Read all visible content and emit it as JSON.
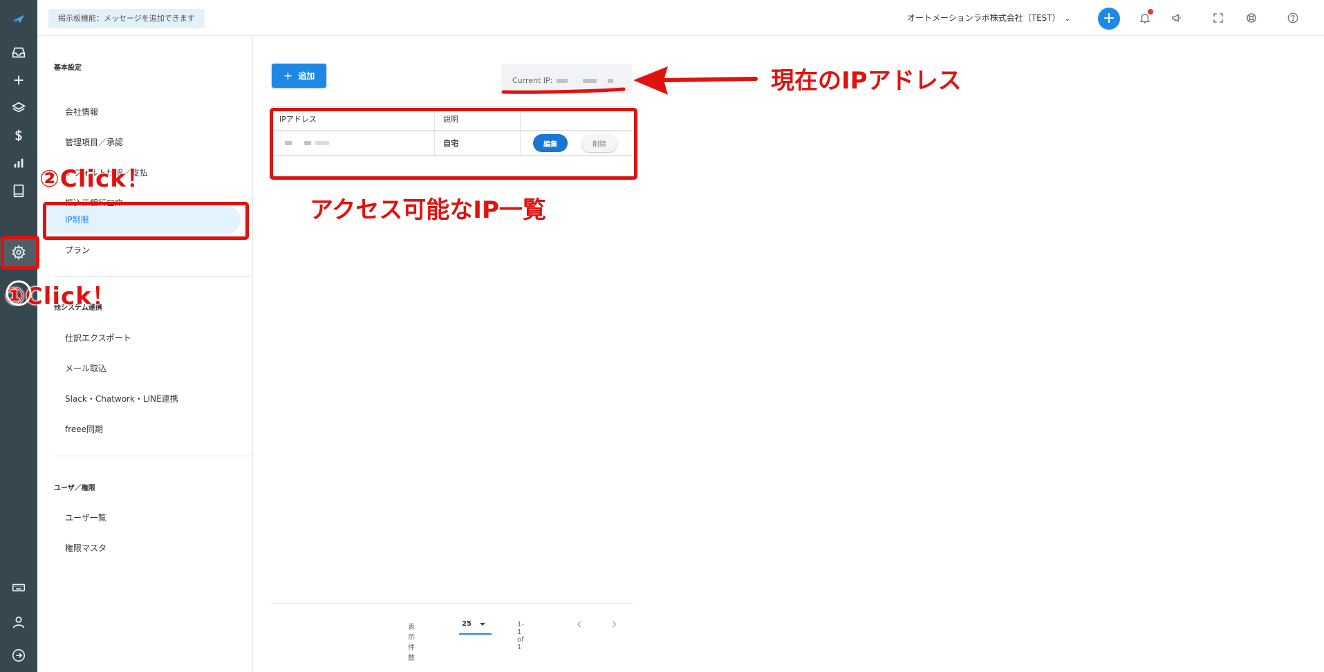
{
  "rail": {
    "icons": [
      "logo-icon",
      "inbox-icon",
      "plus-icon",
      "layers-icon",
      "dollar-icon",
      "bar-chart-icon",
      "book-icon",
      "gear-icon",
      "keyboard-icon",
      "user-icon",
      "logout-icon"
    ]
  },
  "header": {
    "board_message": "掲示板機能：メッセージを追加できます",
    "company": "オートメーションラボ株式会社（TEST）",
    "add_symbol": "+"
  },
  "sidebar": {
    "sections": [
      {
        "title": "基本設定",
        "items": [
          "会社情報",
          "管理項目／承認",
          "デフォルト仕訳／支払",
          "振込元銀行口座",
          "IP制限",
          "プラン"
        ]
      },
      {
        "title": "他システム連携",
        "items": [
          "仕訳エクスポート",
          "メール取込",
          "Slack・Chatwork・LINE連携",
          "freee同期"
        ]
      },
      {
        "title": "ユーザ／権限",
        "items": [
          "ユーザ一覧",
          "権限マスタ"
        ]
      }
    ],
    "active_item": "IP制限"
  },
  "main": {
    "add_button": "追加",
    "current_ip_label": "Current IP:",
    "table": {
      "headers": [
        "IPアドレス",
        "説明",
        ""
      ],
      "rows": [
        {
          "description": "自宅",
          "edit": "編集",
          "delete": "削除"
        }
      ]
    },
    "pager": {
      "per_page_label": "表示件数",
      "per_page_value": "25",
      "range": "1-1 of 1"
    }
  },
  "annotations": {
    "step1": "①Click！",
    "step2": "②Click！",
    "current_ip_note": "現在のIPアドレス",
    "ip_list_note": "アクセス可能なIP一覧"
  },
  "colors": {
    "rail_bg": "#37474f",
    "accent_blue": "#1e88e5",
    "annotation_red": "#e0120f"
  }
}
